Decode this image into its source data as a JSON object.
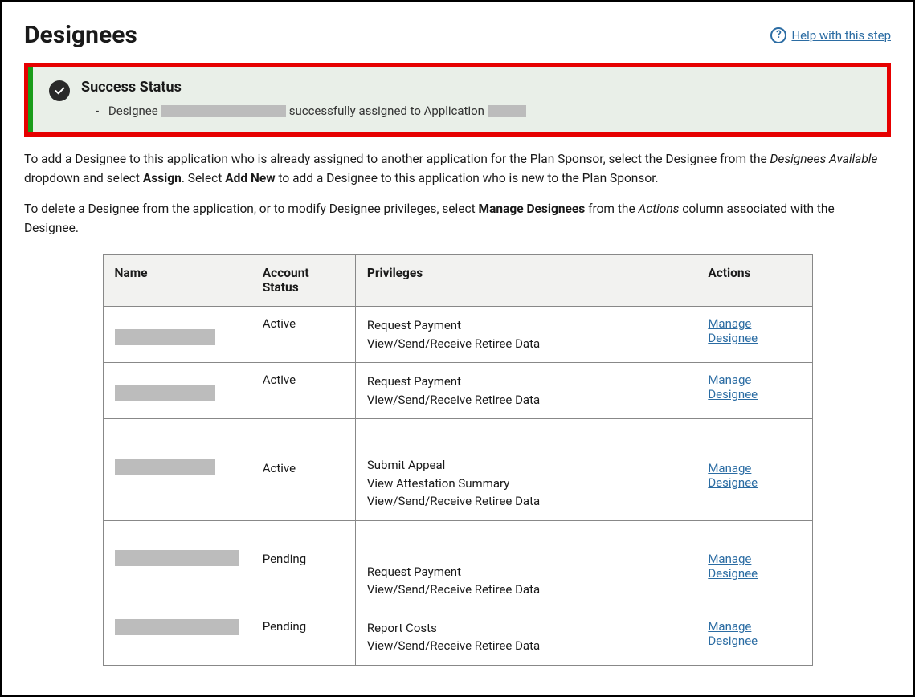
{
  "header": {
    "title": "Designees",
    "help_label": "Help with this step"
  },
  "alert": {
    "title": "Success Status",
    "bullet": "-",
    "msg_prefix": "Designee",
    "msg_middle": "successfully assigned to Application"
  },
  "intro": {
    "p1_a": "To add a Designee to this application who is already assigned to another application for the Plan Sponsor, select the Designee from the ",
    "p1_em": "Designees Available",
    "p1_b": " dropdown and select ",
    "p1_s1": "Assign",
    "p1_c": ". Select ",
    "p1_s2": "Add New",
    "p1_d": " to add a Designee to this application who is new to the Plan Sponsor.",
    "p2_a": "To delete a Designee from the application, or to modify Designee privileges, select ",
    "p2_s1": "Manage Designees",
    "p2_b": " from the ",
    "p2_em": "Actions",
    "p2_c": " column associated with the Designee."
  },
  "table": {
    "headers": {
      "name": "Name",
      "status": "Account Status",
      "privileges": "Privileges",
      "actions": "Actions"
    },
    "action_label": "Manage Designee",
    "rows": [
      {
        "status": "Active",
        "privileges": [
          "Request Payment",
          "View/Send/Receive Retiree Data"
        ]
      },
      {
        "status": "Active",
        "privileges": [
          "Request Payment",
          "View/Send/Receive Retiree Data"
        ]
      },
      {
        "status": "Active",
        "privileges": [
          "Submit Appeal",
          "View Attestation Summary",
          "View/Send/Receive Retiree Data"
        ]
      },
      {
        "status": "Pending",
        "privileges": [
          "Request Payment",
          "View/Send/Receive Retiree Data"
        ]
      },
      {
        "status": "Pending",
        "privileges": [
          "Report Costs",
          "View/Send/Receive Retiree Data"
        ]
      }
    ]
  }
}
